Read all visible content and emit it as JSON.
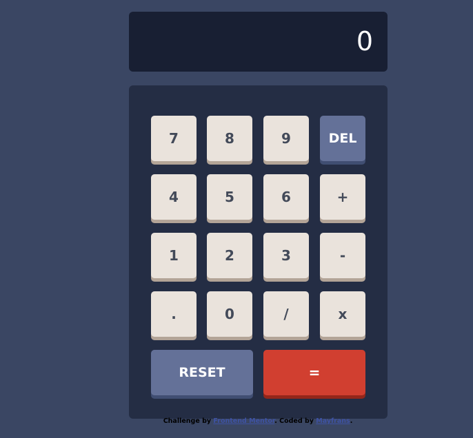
{
  "display": {
    "value": "0"
  },
  "keys": {
    "k7": "7",
    "k8": "8",
    "k9": "9",
    "del": "DEL",
    "k4": "4",
    "k5": "5",
    "k6": "6",
    "plus": "+",
    "k1": "1",
    "k2": "2",
    "k3": "3",
    "minus": "-",
    "dot": ".",
    "k0": "0",
    "divide": "/",
    "multiply": "x",
    "reset": "RESET",
    "equals": "="
  },
  "footer": {
    "prefix": "Challenge by ",
    "challenge_link": "Frontend Mentor",
    "middle": ". Coded by ",
    "author_link": "Mayfrans",
    "suffix": "."
  },
  "colors": {
    "page_bg": "#3a4663",
    "screen_bg": "#181f33",
    "keypad_bg": "#242d44",
    "key_bg": "#eae3dc",
    "accent_blue": "#647198",
    "accent_red": "#d13f30"
  }
}
